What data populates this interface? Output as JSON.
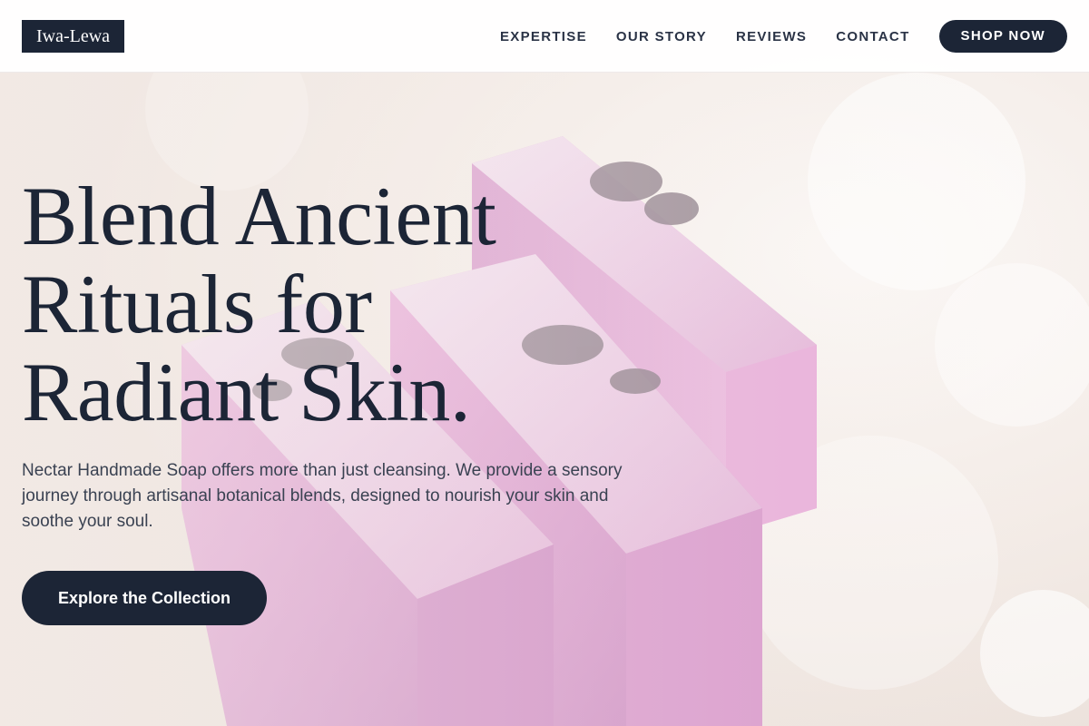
{
  "header": {
    "logo_text": "Iwa-Lewa",
    "nav": [
      {
        "label": "EXPERTISE"
      },
      {
        "label": "OUR STORY"
      },
      {
        "label": "REVIEWS"
      },
      {
        "label": "CONTACT"
      }
    ],
    "cta_label": "SHOP NOW"
  },
  "hero": {
    "title_lines": [
      "Blend Ancient",
      "Rituals for",
      "Radiant Skin."
    ],
    "description": "Nectar Handmade Soap offers more than just cleansing. We provide a sensory journey through artisanal botanical blends, designed to nourish your skin and soothe your soul.",
    "button_label": "Explore the Collection",
    "image_subject": "lavender-soap-bars"
  },
  "colors": {
    "primary": "#1c2536",
    "soap": "#d99ccf",
    "background": "#f5eeea"
  }
}
